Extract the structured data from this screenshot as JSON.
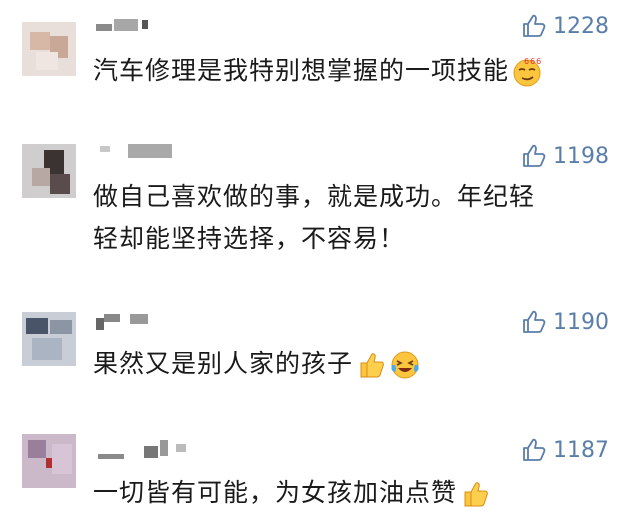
{
  "comments": [
    {
      "likes": "1228",
      "text": "汽车修理是我特别想掌握的一项技能",
      "emojis": [
        "smirk-666-emoji"
      ]
    },
    {
      "likes": "1198",
      "text_line1": "做自己喜欢做的事，就是成功。年纪轻",
      "text_line2": "轻却能坚持选择，不容易！",
      "emojis": []
    },
    {
      "likes": "1190",
      "text": "果然又是别人家的孩子",
      "emojis": [
        "thumbs-up-emoji",
        "laughing-crying-emoji"
      ]
    },
    {
      "likes": "1187",
      "text": "一切皆有可能，为女孩加油点赞",
      "emojis": [
        "thumbs-up-emoji"
      ]
    }
  ],
  "colors": {
    "like_color": "#5a7eaa",
    "text_color": "#1a1a1a",
    "background": "#ffffff"
  }
}
